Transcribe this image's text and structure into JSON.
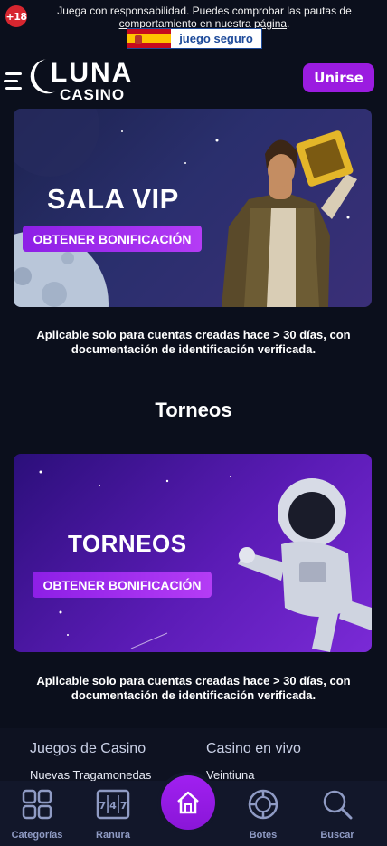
{
  "topbar": {
    "age_badge": "+18",
    "notice_prefix": "Juega con responsabilidad. Puedes comprobar las pautas de",
    "notice_link": "comportamiento en nuestra página",
    "notice_suffix": ".",
    "seal_text": "juego seguro"
  },
  "header": {
    "logo_top": "LUNA",
    "logo_bottom": "CASINO",
    "join_button": "Unirse"
  },
  "promos": [
    {
      "title": "SALA VIP",
      "button": "OBTENER BONIFICACIÓN",
      "note_line1": "Aplicable solo para cuentas creadas hace > 30 días, con",
      "note_line2": "documentación de identificación verificada."
    },
    {
      "title": "TORNEOS",
      "button": "OBTENER BONIFICACIÓN",
      "note_line1": "Aplicable solo para cuentas creadas hace > 30 días, con",
      "note_line2": "documentación de identificación verificada."
    }
  ],
  "section_title": "Torneos",
  "footer": {
    "columns": [
      {
        "title": "Juegos de Casino",
        "first_item": "Nuevas Tragamonedas"
      },
      {
        "title": "Casino en vivo",
        "first_item": "Veintiuna"
      }
    ]
  },
  "bottom_nav": {
    "items": [
      {
        "label": "Categorías",
        "icon": "grid-icon"
      },
      {
        "label": "Ranura",
        "icon": "slot-machine-icon"
      },
      {
        "label": "",
        "icon": "home-icon"
      },
      {
        "label": "Botes",
        "icon": "poker-chip-icon"
      },
      {
        "label": "Buscar",
        "icon": "search-icon"
      }
    ],
    "slot_digits": "7|4|7"
  },
  "colors": {
    "accent": "#9b1ce0",
    "background": "#0b0f1c",
    "nav_label": "#8f9bc4"
  }
}
